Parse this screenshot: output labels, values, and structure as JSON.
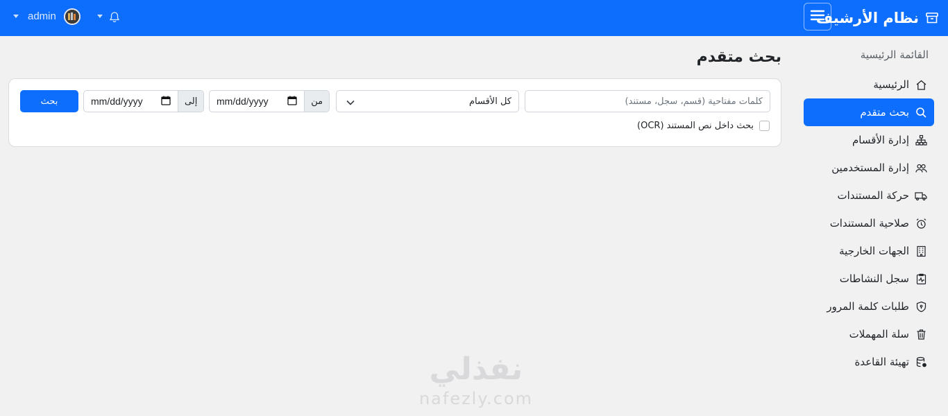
{
  "app": {
    "title": "نظام الأرشيف",
    "username": "admin"
  },
  "sidebar": {
    "heading": "القائمة الرئيسية",
    "items": [
      {
        "label": "الرئيسية",
        "icon": "home-icon"
      },
      {
        "label": "بحث متقدم",
        "icon": "search-icon",
        "active": true
      },
      {
        "label": "إدارة الأقسام",
        "icon": "sitemap-icon"
      },
      {
        "label": "إدارة المستخدمين",
        "icon": "users-icon"
      },
      {
        "label": "حركة المستندات",
        "icon": "truck-icon"
      },
      {
        "label": "صلاحية المستندات",
        "icon": "alarm-icon"
      },
      {
        "label": "الجهات الخارجية",
        "icon": "building-icon"
      },
      {
        "label": "سجل النشاطات",
        "icon": "activity-icon"
      },
      {
        "label": "طلبات كلمة المرور",
        "icon": "shield-icon"
      },
      {
        "label": "سلة المهملات",
        "icon": "trash-icon"
      },
      {
        "label": "تهيئة القاعدة",
        "icon": "database-icon"
      }
    ]
  },
  "main": {
    "title": "بحث متقدم",
    "search": {
      "keywords_placeholder": "كلمات مفتاحية (قسم، سجل، مستند)",
      "keywords_value": "",
      "department_selected": "كل الأقسام",
      "from_label": "من",
      "to_label": "إلى",
      "from_date": "mm/dd/yyyy",
      "to_date": "mm/dd/yyyy",
      "submit_label": "بحث",
      "ocr_label": "بحث داخل نص المستند (OCR)",
      "ocr_checked": false
    }
  },
  "watermark": {
    "ar": "نفذلي",
    "en": "nafezly.com"
  },
  "colors": {
    "primary": "#0d6efd",
    "background": "#f1f1f2"
  }
}
